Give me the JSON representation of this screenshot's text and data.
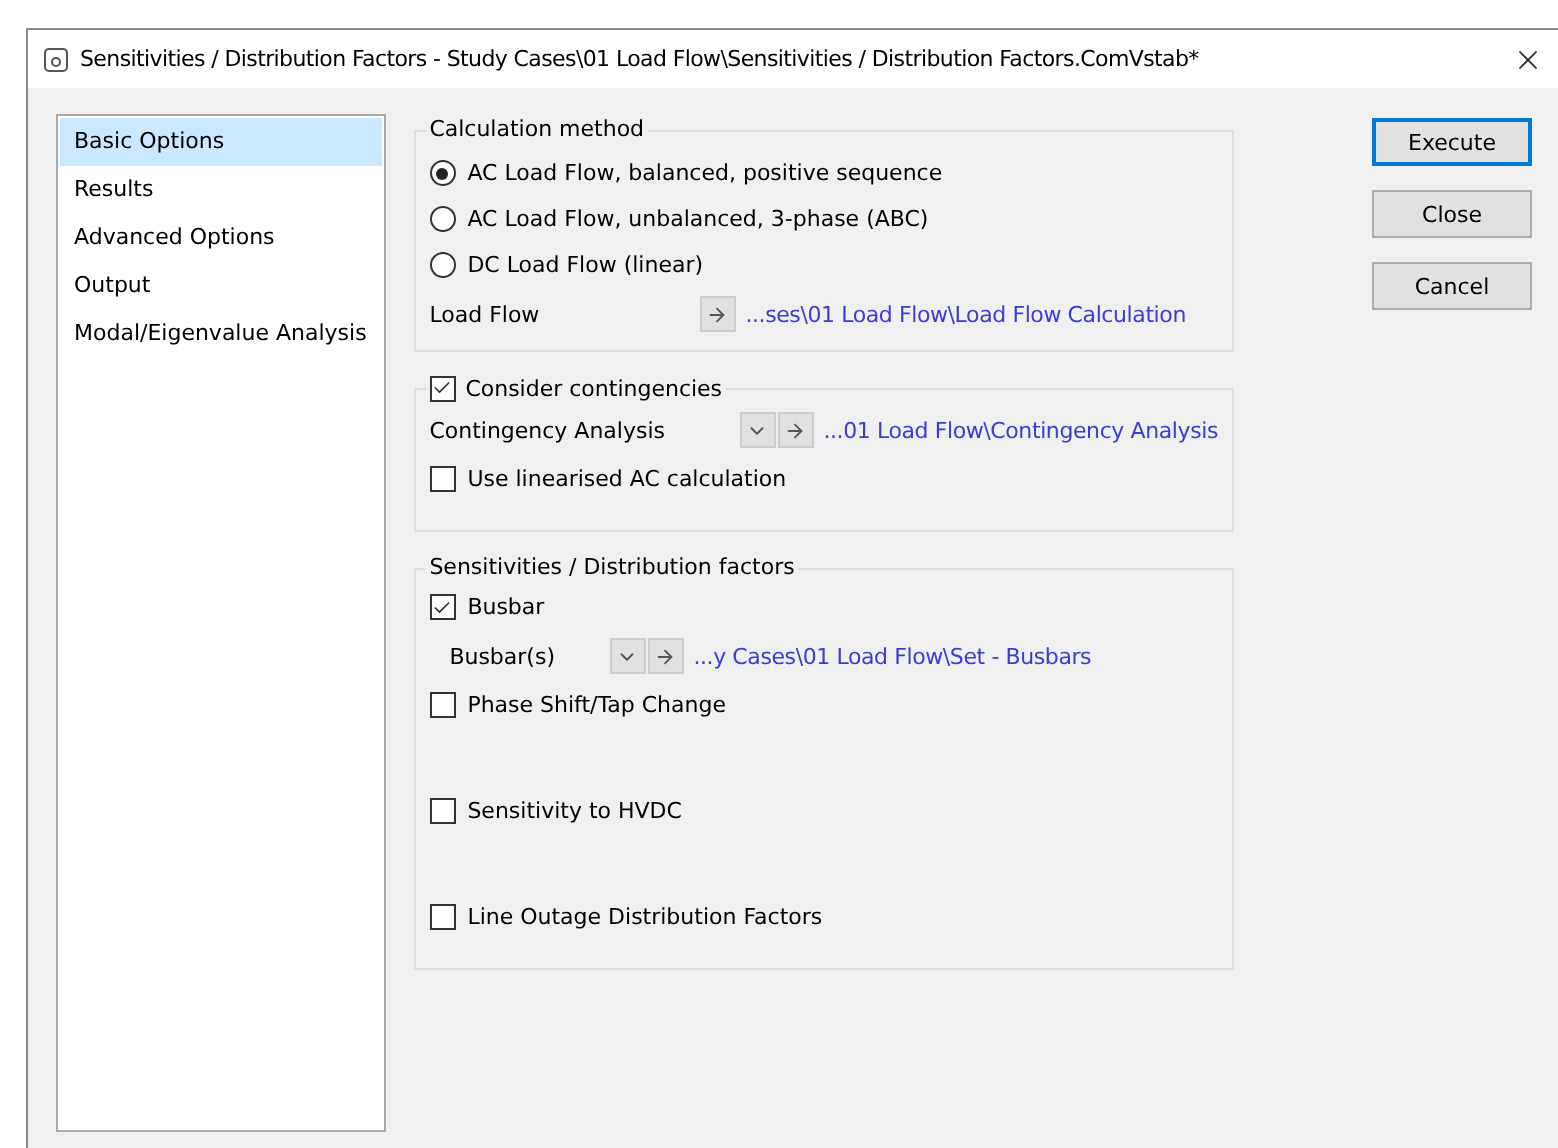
{
  "window": {
    "title": "Sensitivities / Distribution Factors - Study Cases\\01 Load Flow\\Sensitivities / Distribution Factors.ComVstab*"
  },
  "sidebar": {
    "items": [
      {
        "label": "Basic Options",
        "selected": true
      },
      {
        "label": "Results",
        "selected": false
      },
      {
        "label": "Advanced Options",
        "selected": false
      },
      {
        "label": "Output",
        "selected": false
      },
      {
        "label": "Modal/Eigenvalue Analysis",
        "selected": false
      }
    ]
  },
  "calculation": {
    "title": "Calculation method",
    "options": [
      {
        "label": "AC Load Flow, balanced, positive sequence",
        "selected": true
      },
      {
        "label": "AC Load Flow, unbalanced, 3-phase (ABC)",
        "selected": false
      },
      {
        "label": "DC Load Flow (linear)",
        "selected": false
      }
    ],
    "reference": {
      "label": "Load Flow",
      "link": "...ses\\01 Load Flow\\Load Flow Calculation"
    }
  },
  "contingencies": {
    "label": "Consider contingencies",
    "checked": true,
    "reference": {
      "label": "Contingency Analysis",
      "link": "...01 Load Flow\\Contingency Analysis",
      "dropdown": true
    },
    "linearised": {
      "label": "Use linearised AC calculation",
      "checked": false
    }
  },
  "sensitivities": {
    "title": "Sensitivities / Distribution factors",
    "items": [
      {
        "label": "Busbar",
        "checked": true,
        "reference": {
          "label": "Busbar(s)",
          "link": "...y Cases\\01 Load Flow\\Set - Busbars",
          "dropdown": true
        }
      },
      {
        "label": "Phase Shift/Tap Change",
        "checked": false
      },
      {
        "label": "Sensitivity to HVDC",
        "checked": false
      },
      {
        "label": "Line Outage Distribution Factors",
        "checked": false
      }
    ]
  },
  "buttons": [
    {
      "label": "Execute",
      "default": true
    },
    {
      "label": "Close",
      "default": false
    },
    {
      "label": "Cancel",
      "default": false
    }
  ]
}
